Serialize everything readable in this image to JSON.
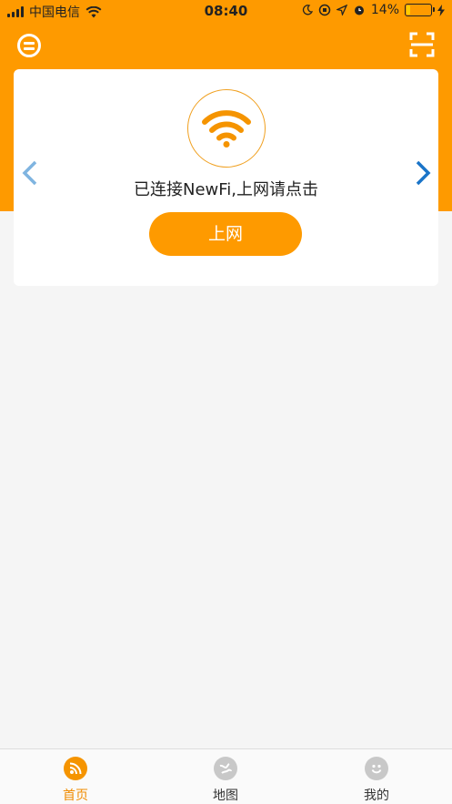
{
  "status_bar": {
    "carrier": "中国电信",
    "time": "08:40",
    "battery": "14%",
    "battery_level": 0.14
  },
  "header": {
    "menu_icon": "menu-circle-icon",
    "scan_icon": "scan-icon"
  },
  "card": {
    "status_text": "已连接NewFi,上网请点击",
    "connect_label": "上网",
    "wifi_icon": "wifi-icon",
    "prev_icon": "chevron-left-icon",
    "next_icon": "chevron-right-icon"
  },
  "tabs": [
    {
      "label": "首页",
      "icon": "rss-icon",
      "active": true
    },
    {
      "label": "地图",
      "icon": "globe-icon",
      "active": false
    },
    {
      "label": "我的",
      "icon": "smiley-icon",
      "active": false
    }
  ],
  "colors": {
    "accent": "#fe9a00",
    "arrow_left": "#7fb4e0",
    "arrow_right": "#1a74c8",
    "tab_inactive_icon": "#c8c8c8",
    "background": "#f5f5f5"
  }
}
